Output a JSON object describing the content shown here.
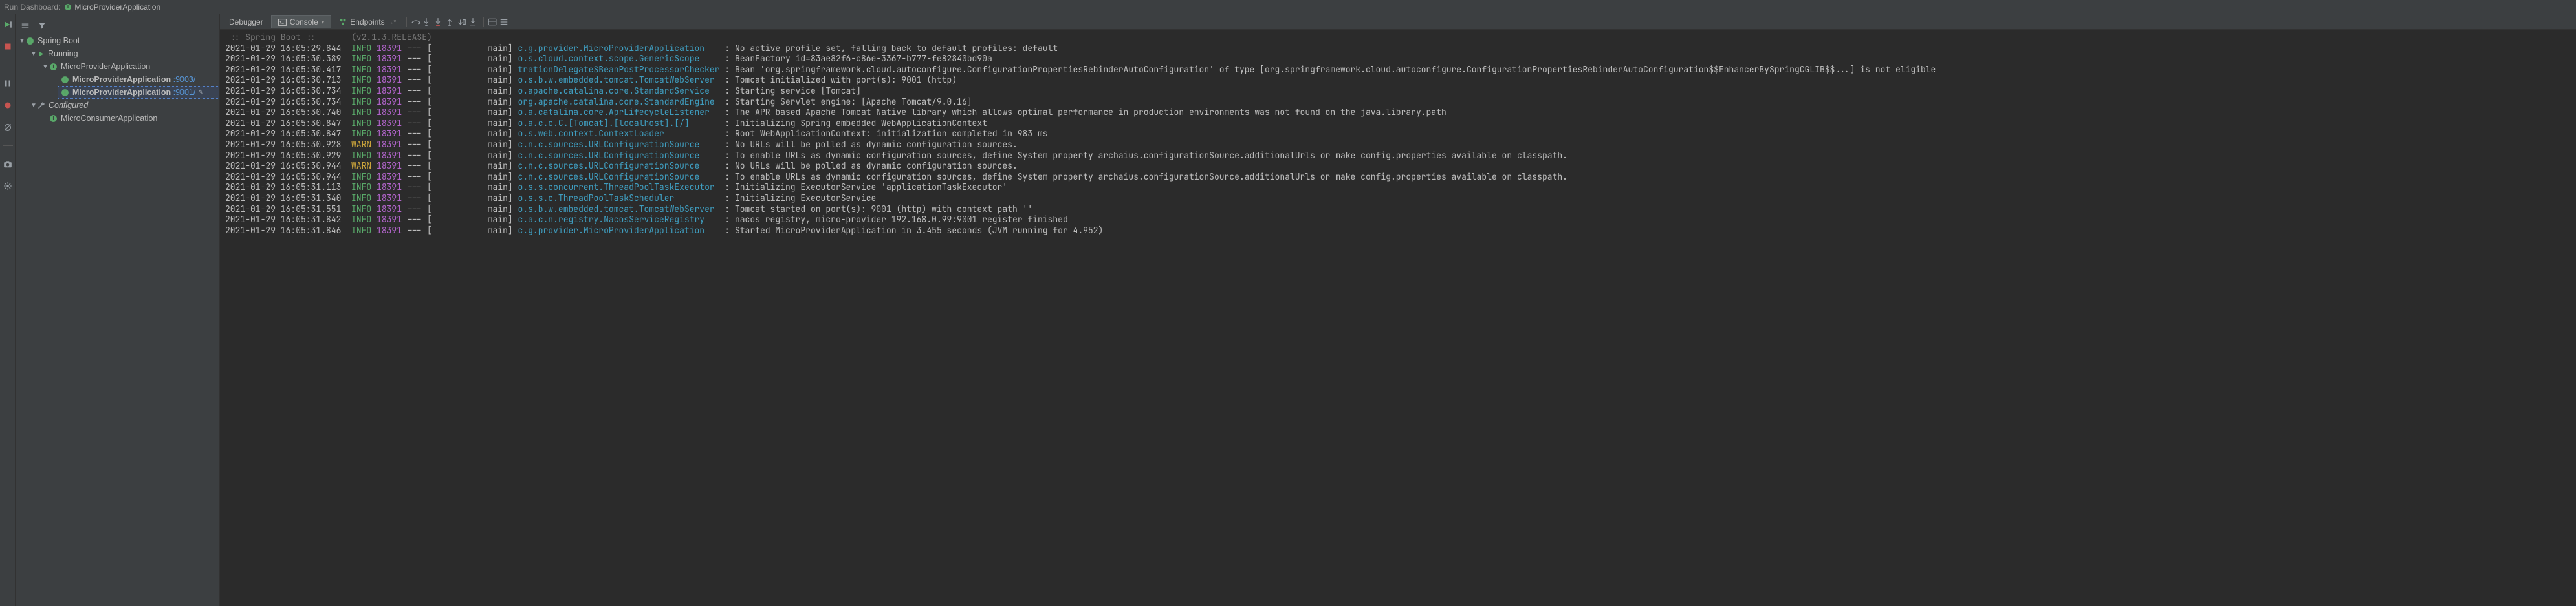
{
  "header": {
    "title_label": "Run Dashboard:",
    "current": "MicroProviderApplication"
  },
  "tree": {
    "root": "Spring Boot",
    "running_label": "Running",
    "configured_label": "Configured",
    "running_parent": "MicroProviderApplication",
    "running_children": [
      {
        "name": "MicroProviderApplication",
        "port": ":9003/",
        "selected": false,
        "editing": false
      },
      {
        "name": "MicroProviderApplication",
        "port": ":9001/",
        "selected": true,
        "editing": true
      }
    ],
    "configured_children": [
      {
        "name": "MicroConsumerApplication"
      }
    ]
  },
  "console_tabs": {
    "debugger": "Debugger",
    "console": "Console",
    "endpoints": "Endpoints"
  },
  "banner_line": " :: Spring Boot ::       (v2.1.3.RELEASE)",
  "logs": [
    {
      "ts": "2021-01-29 16:05:29.844",
      "lvl": "INFO",
      "pid": "18391",
      "thr": "main",
      "logger": "c.g.provider.MicroProviderApplication   ",
      "msg": "No active profile set, falling back to default profiles: default"
    },
    {
      "ts": "2021-01-29 16:05:30.389",
      "lvl": "INFO",
      "pid": "18391",
      "thr": "main",
      "logger": "o.s.cloud.context.scope.GenericScope    ",
      "msg": "BeanFactory id=83ae82f6-c86e-3367-b777-fe82840bd90a"
    },
    {
      "ts": "2021-01-29 16:05:30.417",
      "lvl": "INFO",
      "pid": "18391",
      "thr": "main",
      "logger": "trationDelegate$BeanPostProcessorChecker",
      "msg": "Bean 'org.springframework.cloud.autoconfigure.ConfigurationPropertiesRebinderAutoConfiguration' of type [org.springframework.cloud.autoconfigure.ConfigurationPropertiesRebinderAutoConfiguration$$EnhancerBySpringCGLIB$$...] is not eligible"
    },
    {
      "ts": "2021-01-29 16:05:30.713",
      "lvl": "INFO",
      "pid": "18391",
      "thr": "main",
      "logger": "o.s.b.w.embedded.tomcat.TomcatWebServer ",
      "msg": "Tomcat initialized with port(s): 9001 (http)"
    },
    {
      "ts": "2021-01-29 16:05:30.734",
      "lvl": "INFO",
      "pid": "18391",
      "thr": "main",
      "logger": "o.apache.catalina.core.StandardService  ",
      "msg": "Starting service [Tomcat]"
    },
    {
      "ts": "2021-01-29 16:05:30.734",
      "lvl": "INFO",
      "pid": "18391",
      "thr": "main",
      "logger": "org.apache.catalina.core.StandardEngine ",
      "msg": "Starting Servlet engine: [Apache Tomcat/9.0.16]"
    },
    {
      "ts": "2021-01-29 16:05:30.740",
      "lvl": "INFO",
      "pid": "18391",
      "thr": "main",
      "logger": "o.a.catalina.core.AprLifecycleListener  ",
      "msg": "The APR based Apache Tomcat Native library which allows optimal performance in production environments was not found on the java.library.path"
    },
    {
      "ts": "2021-01-29 16:05:30.847",
      "lvl": "INFO",
      "pid": "18391",
      "thr": "main",
      "logger": "o.a.c.c.C.[Tomcat].[localhost].[/]      ",
      "msg": "Initializing Spring embedded WebApplicationContext"
    },
    {
      "ts": "2021-01-29 16:05:30.847",
      "lvl": "INFO",
      "pid": "18391",
      "thr": "main",
      "logger": "o.s.web.context.ContextLoader           ",
      "msg": "Root WebApplicationContext: initialization completed in 983 ms"
    },
    {
      "ts": "2021-01-29 16:05:30.928",
      "lvl": "WARN",
      "pid": "18391",
      "thr": "main",
      "logger": "c.n.c.sources.URLConfigurationSource    ",
      "msg": "No URLs will be polled as dynamic configuration sources."
    },
    {
      "ts": "2021-01-29 16:05:30.929",
      "lvl": "INFO",
      "pid": "18391",
      "thr": "main",
      "logger": "c.n.c.sources.URLConfigurationSource    ",
      "msg": "To enable URLs as dynamic configuration sources, define System property archaius.configurationSource.additionalUrls or make config.properties available on classpath."
    },
    {
      "ts": "2021-01-29 16:05:30.944",
      "lvl": "WARN",
      "pid": "18391",
      "thr": "main",
      "logger": "c.n.c.sources.URLConfigurationSource    ",
      "msg": "No URLs will be polled as dynamic configuration sources."
    },
    {
      "ts": "2021-01-29 16:05:30.944",
      "lvl": "INFO",
      "pid": "18391",
      "thr": "main",
      "logger": "c.n.c.sources.URLConfigurationSource    ",
      "msg": "To enable URLs as dynamic configuration sources, define System property archaius.configurationSource.additionalUrls or make config.properties available on classpath."
    },
    {
      "ts": "2021-01-29 16:05:31.113",
      "lvl": "INFO",
      "pid": "18391",
      "thr": "main",
      "logger": "o.s.s.concurrent.ThreadPoolTaskExecutor ",
      "msg": "Initializing ExecutorService 'applicationTaskExecutor'"
    },
    {
      "ts": "2021-01-29 16:05:31.340",
      "lvl": "INFO",
      "pid": "18391",
      "thr": "main",
      "logger": "o.s.s.c.ThreadPoolTaskScheduler         ",
      "msg": "Initializing ExecutorService"
    },
    {
      "ts": "2021-01-29 16:05:31.551",
      "lvl": "INFO",
      "pid": "18391",
      "thr": "main",
      "logger": "o.s.b.w.embedded.tomcat.TomcatWebServer ",
      "msg": "Tomcat started on port(s): 9001 (http) with context path ''"
    },
    {
      "ts": "2021-01-29 16:05:31.842",
      "lvl": "INFO",
      "pid": "18391",
      "thr": "main",
      "logger": "c.a.c.n.registry.NacosServiceRegistry   ",
      "msg": "nacos registry, micro-provider 192.168.0.99:9001 register finished"
    },
    {
      "ts": "2021-01-29 16:05:31.846",
      "lvl": "INFO",
      "pid": "18391",
      "thr": "main",
      "logger": "c.g.provider.MicroProviderApplication   ",
      "msg": "Started MicroProviderApplication in 3.455 seconds (JVM running for 4.952)"
    }
  ]
}
